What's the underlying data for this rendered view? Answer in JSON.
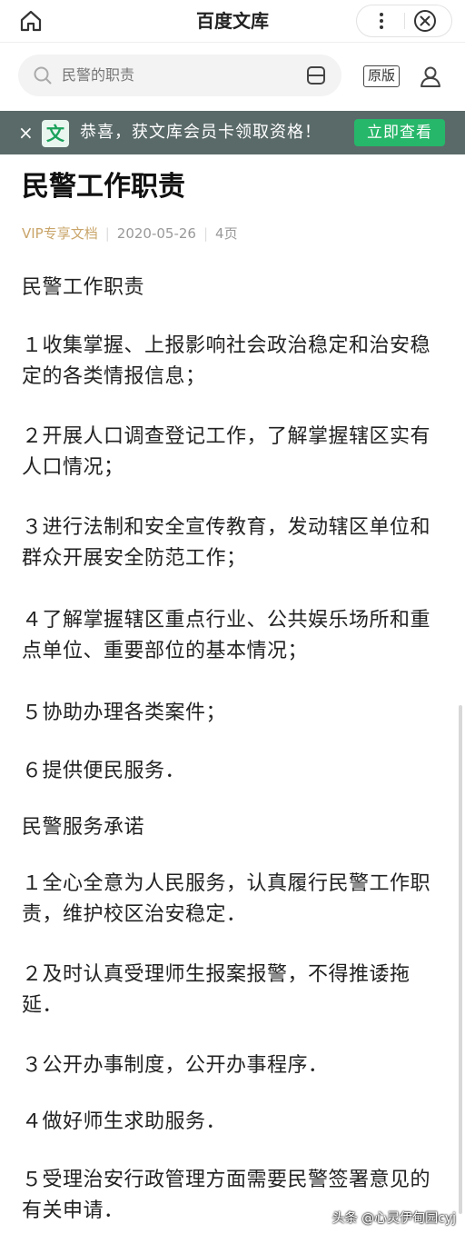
{
  "header": {
    "title": "百度文库"
  },
  "search": {
    "placeholder": "民警的职责"
  },
  "toolbar": {
    "original_label": "原版"
  },
  "banner": {
    "close_glyph": "×",
    "logo_glyph": "文",
    "text": "恭喜，获文库会员卡领取资格！",
    "button_label": "立即查看"
  },
  "document": {
    "title": "民警工作职责",
    "meta": {
      "tag": "VIP专享文档",
      "date": "2020-05-26",
      "pages": "4页"
    },
    "paragraphs": [
      "民警工作职责",
      "１收集掌握、上报影响社会政治稳定和治安稳定的各类情报信息；",
      "２开展人口调查登记工作，了解掌握辖区实有人口情况；",
      "３进行法制和安全宣传教育，发动辖区单位和群众开展安全防范工作；",
      "４了解掌握辖区重点行业、公共娱乐场所和重点单位、重要部位的基本情况；",
      "５协助办理各类案件；",
      "６提供便民服务．",
      "民警服务承诺",
      "１全心全意为人民服务，认真履行民警工作职责，维护校区治安稳定．",
      "２及时认真受理师生报案报警，不得推诿拖延．",
      "３公开办事制度，公开办事程序．",
      "４做好师生求助服务．",
      "５受理治安行政管理方面需要民警签署意见的有关申请．"
    ]
  },
  "watermark": "头条 @心灵伊甸园cyj",
  "colors": {
    "accent_green": "#27b76a",
    "banner_bg": "#5a6a69",
    "vip_gold": "#c9a56a"
  },
  "icons": [
    "home-icon",
    "more-icon",
    "close-circle-icon",
    "search-icon",
    "scan-icon",
    "user-icon"
  ]
}
